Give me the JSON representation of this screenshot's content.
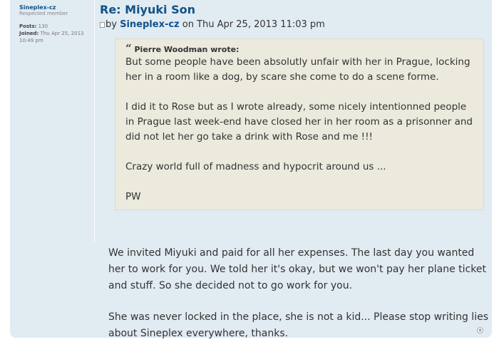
{
  "profile": {
    "author": "Sineplex-cz",
    "rank": "Respected member",
    "posts_label": "Posts:",
    "posts_value": "130",
    "joined_label": "Joined:",
    "joined_value": "Thu Apr 25, 2013 10:49 pm"
  },
  "post": {
    "title": "Re: Miyuki Son",
    "by_label": "by",
    "author": "Sineplex-cz",
    "on_label": "on",
    "timestamp": "Thu Apr 25, 2013 11:03 pm"
  },
  "quote": {
    "author": "Pierre Woodman wrote:",
    "paragraphs": [
      "But some people have been absolutly unfair with her in Prague, locking her in a room like a dog, by scare she come to do a scene forme.",
      "I did it to Rose but as I wrote already, some nicely intentionned people in Prague last week-end have closed her in her room as a prisonner and did not let her go take a drink with Rose and me !!!",
      "Crazy world full of madness and hypocrit around us ...",
      "PW"
    ]
  },
  "body": {
    "paragraphs": [
      "We invited Miyuki and paid for all her expenses. The last day you wanted her to work for you. We told her it's okay, but we won't pay her plane ticket and stuff. So she decided not to go work for you.",
      "She was never locked in the place, she is not a kid... Please stop writing lies about Sineplex everywhere, thanks."
    ]
  },
  "icons": {
    "post_icon": "post-icon",
    "quote_icon": "quote-mark-icon",
    "top_icon": "back-to-top-icon"
  }
}
